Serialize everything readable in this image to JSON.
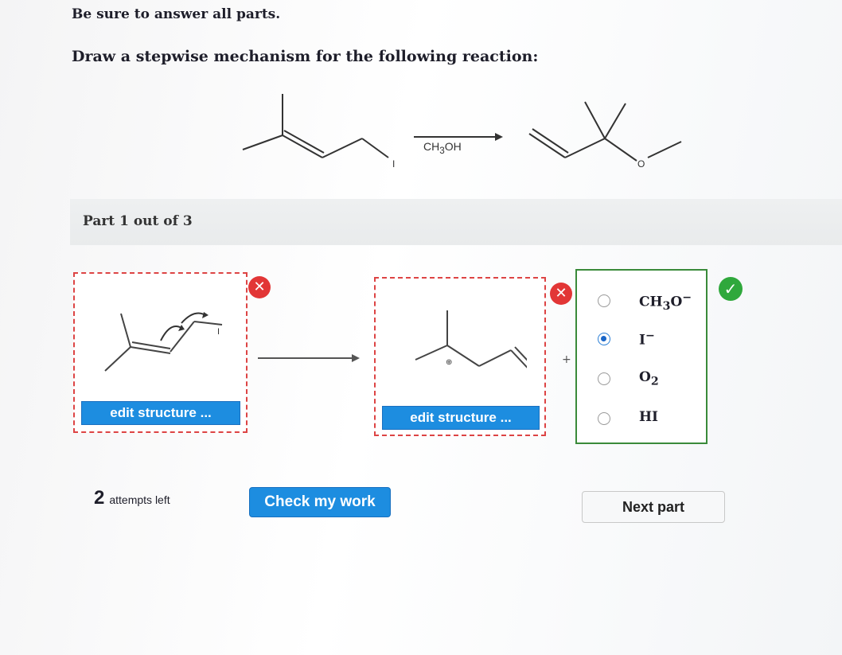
{
  "instructions": {
    "line1": "Be sure to answer all parts.",
    "line2": "Draw a stepwise mechanism for the following reaction:"
  },
  "reaction": {
    "reagent": "CH3OH",
    "reagent_main": "CH",
    "reagent_sub": "3",
    "reagent_tail": "OH",
    "leaving_group_label": "I",
    "product_oxygen_label": "O"
  },
  "part": {
    "label": "Part 1 out of 3"
  },
  "workspace": {
    "left_box": {
      "edit_label": "edit structure ...",
      "status": "incorrect",
      "leaving_group_label": "I"
    },
    "middle_box": {
      "edit_label": "edit structure ...",
      "status": "incorrect",
      "charge_label": "⊕"
    },
    "plus_sign": "+",
    "options": [
      {
        "main": "CH",
        "sub": "3",
        "tail": "O",
        "sup": "−",
        "selected": false
      },
      {
        "main": "I",
        "sub": "",
        "tail": "",
        "sup": "−",
        "selected": true
      },
      {
        "main": "O",
        "sub": "2",
        "tail": "",
        "sup": "",
        "selected": false
      },
      {
        "main": "HI",
        "sub": "",
        "tail": "",
        "sup": "",
        "selected": false
      }
    ],
    "options_status": "correct"
  },
  "footer": {
    "attempts_number": "2",
    "attempts_text": "attempts left",
    "check_button": "Check my work",
    "next_button": "Next part"
  },
  "colors": {
    "accent_blue": "#1d8de0",
    "error_red": "#e23636",
    "success_green": "#2fa83c"
  },
  "icons": {
    "incorrect": "x-mark-icon",
    "correct": "check-mark-icon"
  }
}
